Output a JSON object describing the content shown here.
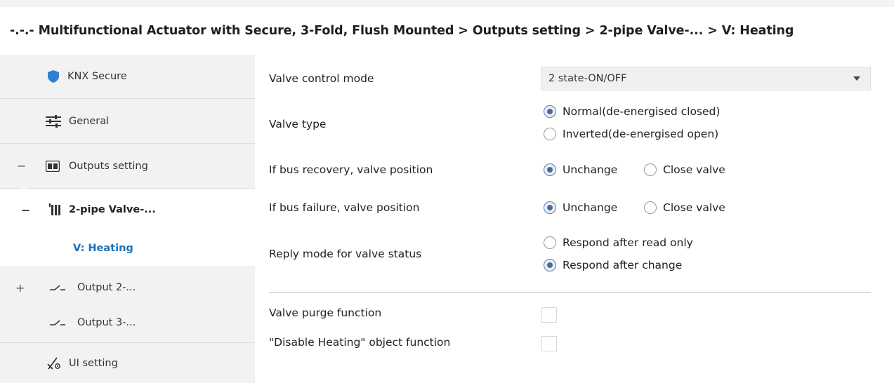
{
  "breadcrumb": {
    "text": "-.-.- Multifunctional Actuator with Secure, 3-Fold, Flush Mounted > Outputs setting > 2-pipe Valve-... > V: Heating"
  },
  "sidebar": {
    "items": [
      {
        "label": "KNX Secure",
        "icon": "shield-icon"
      },
      {
        "label": "General",
        "icon": "sliders-icon"
      },
      {
        "label": "Outputs setting",
        "icon": "outputs-icon",
        "expander": "−"
      },
      {
        "label": "2-pipe Valve-...",
        "icon": "radiator-icon",
        "expander": "−"
      },
      {
        "label": "V: Heating"
      },
      {
        "label": "Output 2-...",
        "icon": "switch-icon",
        "expander": "+"
      },
      {
        "label": "Output 3-...",
        "icon": "switch-icon"
      },
      {
        "label": "UI setting",
        "icon": "ui-setting-icon"
      }
    ]
  },
  "params": {
    "valve_control_mode": {
      "label": "Valve control mode",
      "value": "2 state-ON/OFF"
    },
    "valve_type": {
      "label": "Valve type",
      "options": [
        "Normal(de-energised closed)",
        "Inverted(de-energised open)"
      ],
      "selected": 0
    },
    "bus_recovery": {
      "label": "If bus recovery, valve position",
      "options": [
        "Unchange",
        "Close valve"
      ],
      "selected": 0
    },
    "bus_failure": {
      "label": "If bus failure, valve position",
      "options": [
        "Unchange",
        "Close valve"
      ],
      "selected": 0
    },
    "reply_mode": {
      "label": "Reply mode for valve status",
      "options": [
        "Respond after read only",
        "Respond after change"
      ],
      "selected": 1
    },
    "valve_purge": {
      "label": "Valve purge function",
      "checked": false
    },
    "disable_heating": {
      "label": "\"Disable Heating\" object function",
      "checked": false
    }
  },
  "colors": {
    "accent_blue": "#1f6fb5",
    "shield_blue": "#2f7fd6",
    "sidebar_bg": "#f2f2f2",
    "radio_dot": "#4a6d95"
  }
}
